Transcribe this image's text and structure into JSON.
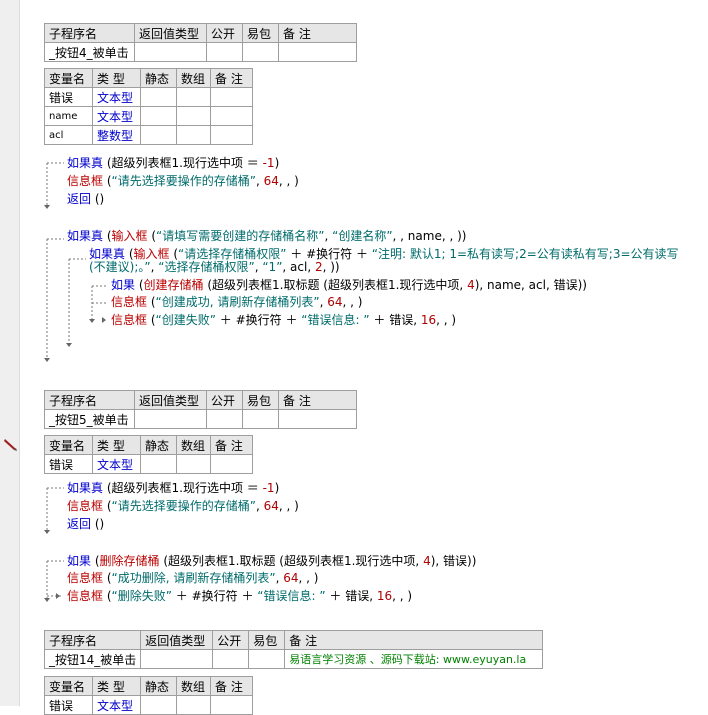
{
  "sub_header": [
    "子程序名",
    "返回值类型",
    "公开",
    "易包",
    "备 注"
  ],
  "var_header": [
    "变量名",
    "类 型",
    "静态",
    "数组",
    "备 注"
  ],
  "sub1": {
    "name": "_按钮4_被单击",
    "vars": [
      {
        "name": "错误",
        "type": "文本型"
      },
      {
        "name": "name",
        "type": "文本型"
      },
      {
        "name": "acl",
        "type": "整数型"
      }
    ]
  },
  "sub2": {
    "name": "_按钮5_被单击",
    "vars": [
      {
        "name": "错误",
        "type": "文本型"
      }
    ]
  },
  "sub3": {
    "name": "_按钮14_被单击",
    "remark": "易语言学习资源 、源码下载站: www.eyuyan.la",
    "vars": [
      {
        "name": "错误",
        "type": "文本型"
      }
    ]
  },
  "code1": {
    "l1": {
      "kw": "如果真",
      "rest": " (超级列表框1.现行选中项 ＝ ",
      "num": "-1",
      "end": ")"
    },
    "l2": {
      "fn": "信息框",
      "a": " (",
      "s": "“请先选择要操作的存储桶”",
      "b": ", ",
      "n": "64",
      "c": ", , )"
    },
    "l3": {
      "kw": "返回",
      "rest": " ()"
    },
    "l4": {
      "kw": "如果真",
      "a": " (",
      "fn": "输入框",
      "b": " (",
      "s1": "“请填写需要创建的存储桶名称”",
      "c": ", ",
      "s2": "“创建名称”",
      "d": ", , name, , ))"
    },
    "l5": {
      "kw": "如果真",
      "a": " (",
      "fn": "输入框",
      "b": " (",
      "s1": "“请选择存储桶权限”",
      "c": " ＋ #换行符 ＋ ",
      "s2": "“注明: 默认1; 1=私有读写;2=公有读私有写;3=公有读写"
    },
    "l6": {
      "s1": "(不建议);。”",
      "a": ", ",
      "s2": "“选择存储桶权限”",
      "b": ", ",
      "s3": "“1”",
      "c": ", acl, ",
      "n": "2",
      "d": ", ))"
    },
    "l7": {
      "kw": "如果",
      "a": " (",
      "fn": "创建存储桶",
      "b": " (超级列表框1.取标题 (超级列表框1.现行选中项, ",
      "n": "4",
      "c": "), name, acl, 错误))"
    },
    "l8": {
      "fn": "信息框",
      "a": " (",
      "s": "“创建成功, 请刷新存储桶列表”",
      "b": ", ",
      "n": "64",
      "c": ", , )"
    },
    "l9": {
      "fn": "信息框",
      "a": " (",
      "s1": "“创建失败”",
      "b": " ＋ #换行符 ＋ ",
      "s2": "“错误信息: ”",
      "c": " ＋ 错误, ",
      "n": "16",
      "d": ", , )"
    }
  },
  "code2": {
    "l1": {
      "kw": "如果真",
      "rest": " (超级列表框1.现行选中项 ＝ ",
      "num": "-1",
      "end": ")"
    },
    "l2": {
      "fn": "信息框",
      "a": " (",
      "s": "“请先选择要操作的存储桶”",
      "b": ", ",
      "n": "64",
      "c": ", , )"
    },
    "l3": {
      "kw": "返回",
      "rest": " ()"
    },
    "l4": {
      "kw": "如果",
      "a": " (",
      "fn": "删除存储桶",
      "b": " (超级列表框1.取标题 (超级列表框1.现行选中项, ",
      "n": "4",
      "c": "), 错误))"
    },
    "l5": {
      "fn": "信息框",
      "a": " (",
      "s": "“成功删除, 请刷新存储桶列表”",
      "b": ", ",
      "n": "64",
      "c": ", , )"
    },
    "l6": {
      "fn": "信息框",
      "a": " (",
      "s1": "“删除失败”",
      "b": " ＋ #换行符 ＋ ",
      "s2": "“错误信息: ”",
      "c": " ＋ 错误, ",
      "n": "16",
      "d": ", , )"
    }
  }
}
